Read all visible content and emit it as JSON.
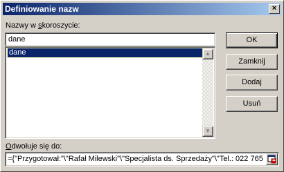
{
  "window": {
    "title": "Definiowanie nazw",
    "close_label": "×"
  },
  "names": {
    "label_prefix": "Nazwy w ",
    "label_underlined": "s",
    "label_suffix": "koroszycie:",
    "input_value": "dane",
    "items": [
      "dane"
    ],
    "selected": "dane"
  },
  "buttons": {
    "ok": "OK",
    "close": "Zamknij",
    "add": "Dodaj",
    "delete": "Usuń"
  },
  "reference": {
    "label_prefix": "",
    "label_underlined": "O",
    "label_suffix": "dwołuje się do:",
    "value": "={\"Przygotował:\"\\\"Rafał Milewski\"\\\"Specjalista ds. Sprzedaży\"\\\"Tel.: 022 765"
  },
  "icons": {
    "close": "close-icon",
    "scroll_up": "arrow-up-icon",
    "scroll_down": "arrow-down-icon",
    "collapse": "collapse-dialog-icon"
  },
  "colors": {
    "titlebar_start": "#0a246a",
    "titlebar_end": "#a6caf0",
    "selection": "#0a246a",
    "face": "#d4d0c8"
  }
}
